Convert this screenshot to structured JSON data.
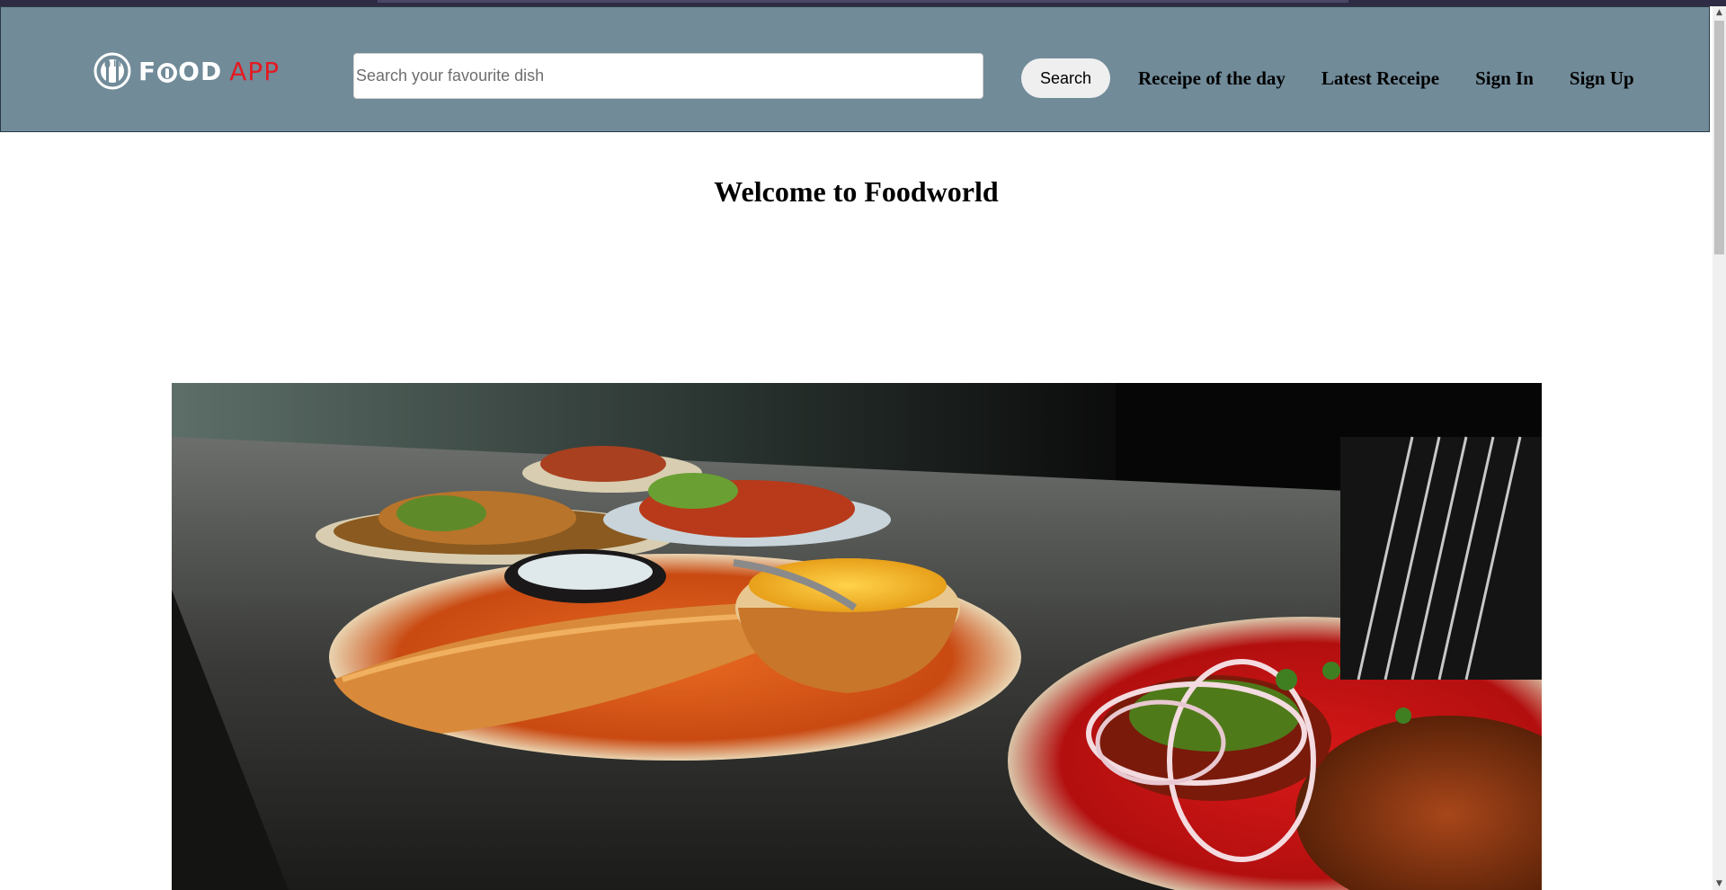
{
  "app": {
    "logo": {
      "text_main": "F",
      "text_rest": "OD",
      "text_app": "APP",
      "icon": "plate-cutlery-icon"
    }
  },
  "search": {
    "placeholder": "Search your favourite dish",
    "value": "",
    "button_label": "Search"
  },
  "nav": {
    "items": [
      {
        "label": "Receipe of the day"
      },
      {
        "label": "Latest Receipe"
      },
      {
        "label": "Sign In"
      },
      {
        "label": "Sign Up"
      }
    ]
  },
  "main": {
    "heading": "Welcome to Foodworld",
    "hero_image": "indian-food-dishes-photo"
  },
  "colors": {
    "header_bg": "#718b99",
    "logo_accent": "#e31b23"
  },
  "scrollbar": {
    "up_icon": "scroll-up-arrow-icon",
    "down_icon": "scroll-down-arrow-icon"
  }
}
